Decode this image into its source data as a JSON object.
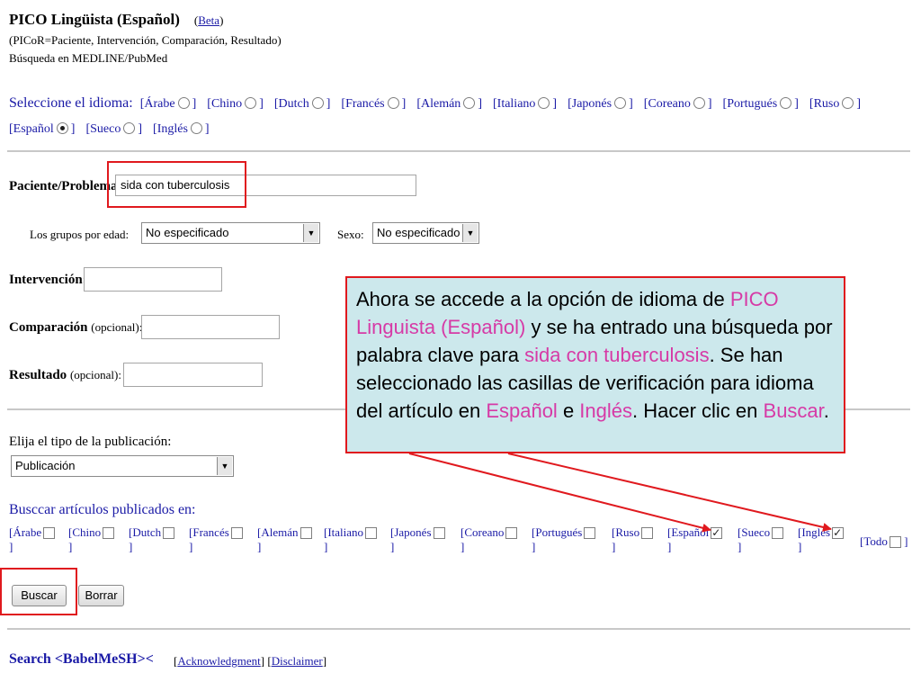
{
  "header": {
    "title": "PICO Lingüista (Español)",
    "beta": "Beta",
    "subtitle": "(PICoR=Paciente, Intervención, Comparación, Resultado)",
    "search_in": "Búsqueda en MEDLINE/PubMed"
  },
  "language_select": {
    "label": "Seleccione el idioma:",
    "options": [
      {
        "label": "Árabe",
        "selected": false
      },
      {
        "label": "Chino",
        "selected": false
      },
      {
        "label": "Dutch",
        "selected": false
      },
      {
        "label": "Francés",
        "selected": false
      },
      {
        "label": "Alemán",
        "selected": false
      },
      {
        "label": "Italiano",
        "selected": false
      },
      {
        "label": "Japonés",
        "selected": false
      },
      {
        "label": "Coreano",
        "selected": false
      },
      {
        "label": "Portugués",
        "selected": false
      },
      {
        "label": "Ruso",
        "selected": false
      },
      {
        "label": "Español",
        "selected": true
      },
      {
        "label": "Sueco",
        "selected": false
      },
      {
        "label": "Inglés",
        "selected": false
      }
    ]
  },
  "form": {
    "patient_label": "Paciente/Problema:",
    "patient_value": "sida con tuberculosis",
    "age_label": "Los grupos por edad:",
    "age_value": "No especificado",
    "sex_label": "Sexo:",
    "sex_value": "No especificado",
    "intervention_label": "Intervención:",
    "comparison_label": "Comparación",
    "comparison_opt": "(opcional):",
    "outcome_label": "Resultado",
    "outcome_opt": "(opcional):",
    "pubtype_label": "Elija el tipo de la publicación:",
    "pubtype_value": "Publicación",
    "article_lang_label": "Busccar artículos publicados en:"
  },
  "article_languages": [
    {
      "label": "Árabe",
      "checked": false
    },
    {
      "label": "Chino",
      "checked": false
    },
    {
      "label": "Dutch",
      "checked": false
    },
    {
      "label": "Francés",
      "checked": false
    },
    {
      "label": "Alemán",
      "checked": false
    },
    {
      "label": "Italiano",
      "checked": false
    },
    {
      "label": "Japonés",
      "checked": false
    },
    {
      "label": "Coreano",
      "checked": false
    },
    {
      "label": "Portugués",
      "checked": false
    },
    {
      "label": "Ruso",
      "checked": false
    },
    {
      "label": "Español",
      "checked": true
    },
    {
      "label": "Sueco",
      "checked": false
    },
    {
      "label": "Inglés",
      "checked": true
    },
    {
      "label": "Todo",
      "checked": false
    }
  ],
  "buttons": {
    "search": "Buscar",
    "clear": "Borrar"
  },
  "footer": {
    "search_label": "Search <BabelMeSH><",
    "acknowledgment": "Acknowledgment",
    "disclaimer": "Disclaimer"
  },
  "callout": {
    "t1": "Ahora se accede a la opción de idioma de ",
    "h1": "PICO Linguista (Español)",
    "t2": " y se ha entrado una búsqueda por palabra clave para ",
    "h2": "sida con tuberculosis",
    "t3": ". Se han seleccionado las casillas de verificación para idioma del artículo en ",
    "h3": "Español",
    "t4": " e ",
    "h4": "Inglés",
    "t5": ". Hacer clic en ",
    "h5": "Buscar",
    "t6": "."
  },
  "colors": {
    "highlight": "#d63aa6",
    "callout_bg": "#cce8ec",
    "annotation_red": "#e0191e",
    "link_blue": "#1a1aa6"
  }
}
